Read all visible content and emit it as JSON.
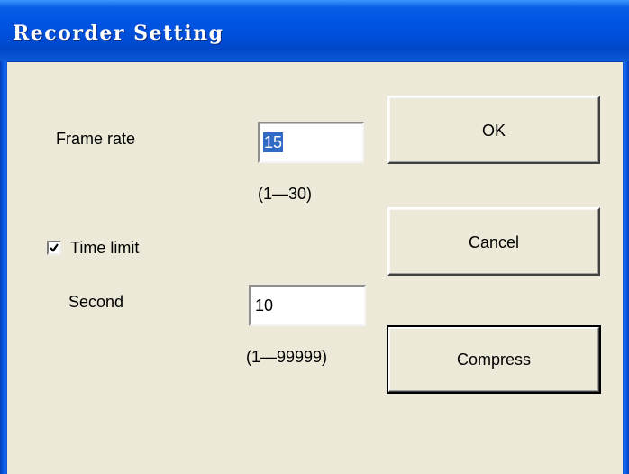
{
  "window": {
    "title": "Recorder Setting"
  },
  "frame_rate": {
    "label": "Frame rate",
    "value": "15",
    "range": "(1—30)"
  },
  "time_limit": {
    "label": "Time limit",
    "checked": true,
    "second_label": "Second",
    "second_value": "10",
    "range": "(1—99999)"
  },
  "buttons": {
    "ok": "OK",
    "cancel": "Cancel",
    "compress": "Compress"
  }
}
